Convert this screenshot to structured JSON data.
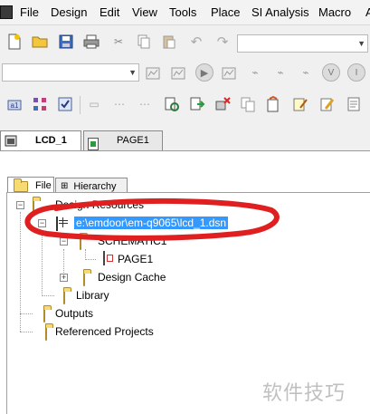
{
  "menu": {
    "items": [
      "File",
      "Design",
      "Edit",
      "View",
      "Tools",
      "Place",
      "SI Analysis",
      "Macro",
      "A"
    ]
  },
  "toolbar": {
    "combo_value": "",
    "search_value": ""
  },
  "doc_tabs": [
    {
      "label": "LCD_1"
    },
    {
      "label": "PAGE1"
    }
  ],
  "panel_tabs": [
    {
      "label": "File"
    },
    {
      "label": "Hierarchy"
    }
  ],
  "tree": {
    "design_resources": "Design Resources",
    "dsn_file": "e:\\emdoor\\em-q9065\\lcd_1.dsn",
    "schematic": "SCHEMATIC1",
    "page": "PAGE1",
    "design_cache": "Design Cache",
    "library": "Library",
    "outputs": "Outputs",
    "referenced_projects": "Referenced Projects"
  },
  "watermark": "软件技巧",
  "colors": {
    "selection": "#3399ff",
    "annotation": "#e02020",
    "folder": "#f8da73"
  }
}
